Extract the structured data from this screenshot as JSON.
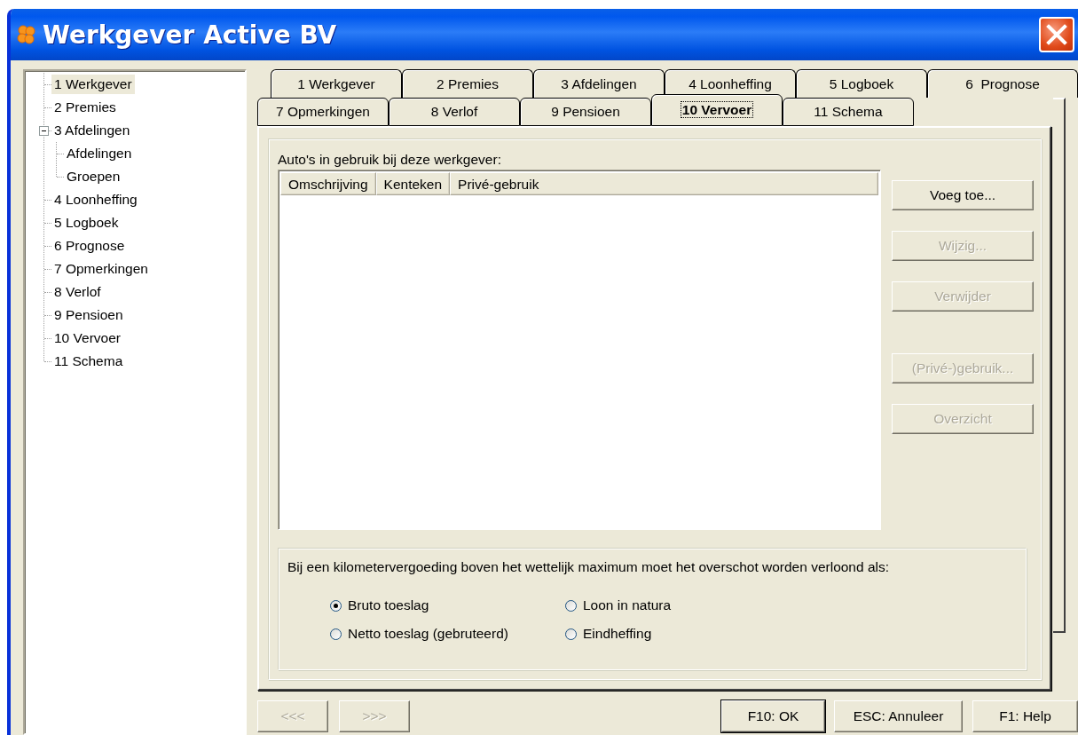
{
  "window": {
    "title": "Werkgever Active BV"
  },
  "tree": [
    {
      "label": "1 Werkgever",
      "selected": true
    },
    {
      "label": "2 Premies",
      "selected": false
    },
    {
      "label": "3 Afdelingen",
      "selected": false,
      "expanded": true,
      "children": [
        {
          "label": "Afdelingen",
          "selected": false
        },
        {
          "label": "Groepen",
          "selected": false
        }
      ]
    },
    {
      "label": "4 Loonheffing",
      "selected": false
    },
    {
      "label": "5 Logboek",
      "selected": false
    },
    {
      "label": "6  Prognose",
      "selected": false
    },
    {
      "label": "7 Opmerkingen",
      "selected": false
    },
    {
      "label": "8 Verlof",
      "selected": false
    },
    {
      "label": "9 Pensioen",
      "selected": false
    },
    {
      "label": "10 Vervoer",
      "selected": false
    },
    {
      "label": "11 Schema",
      "selected": false
    }
  ],
  "tab_rows": [
    {
      "tabs": [
        {
          "label": "1 Werkgever",
          "selected": false
        },
        {
          "label": "2 Premies",
          "selected": false
        },
        {
          "label": "3 Afdelingen",
          "selected": false
        },
        {
          "label": "4 Loonheffing",
          "selected": false
        },
        {
          "label": "5 Logboek",
          "selected": false
        },
        {
          "label": "6  Prognose",
          "selected": false
        }
      ]
    },
    {
      "tabs": [
        {
          "label": "7 Opmerkingen",
          "selected": false
        },
        {
          "label": "8 Verlof",
          "selected": false
        },
        {
          "label": "9 Pensioen",
          "selected": false
        },
        {
          "label": "10 Vervoer",
          "selected": true
        },
        {
          "label": "11 Schema",
          "selected": false
        }
      ]
    }
  ],
  "cars": {
    "label": "Auto's in gebruik bij deze werkgever:",
    "columns": [
      "Omschrijving",
      "Kenteken",
      "Privé-gebruik"
    ],
    "button_groups": [
      [
        {
          "label": "Voeg toe...",
          "disabled": false
        },
        {
          "label": "Wijzig...",
          "disabled": true
        },
        {
          "label": "Verwijder",
          "disabled": true
        }
      ],
      [
        {
          "label": "(Privé-)gebruik...",
          "disabled": true
        },
        {
          "label": "Overzicht",
          "disabled": true
        }
      ]
    ]
  },
  "allowance": {
    "prompt": "Bij een kilometervergoeding boven het wettelijk maximum moet het overschot worden verloond als:",
    "options": [
      {
        "label": "Bruto toeslag",
        "selected": true
      },
      {
        "label": "Loon in natura",
        "selected": false
      },
      {
        "label": "Netto toeslag (gebruteerd)",
        "selected": false
      },
      {
        "label": "Eindheffing",
        "selected": false
      }
    ]
  },
  "footer": {
    "nav": [
      {
        "label": "<<<",
        "disabled": true
      },
      {
        "label": ">>>",
        "disabled": true
      }
    ],
    "actions": [
      {
        "label": "F10: OK",
        "default": true
      },
      {
        "label": "ESC: Annuleer",
        "default": false
      },
      {
        "label": "F1: Help",
        "default": false
      }
    ]
  }
}
